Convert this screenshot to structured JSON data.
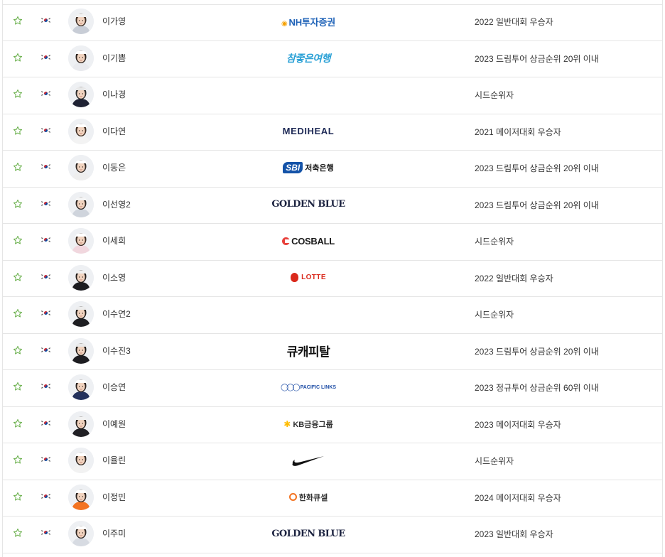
{
  "colors": {
    "favorite_star": "#6ab04c",
    "border": "#e5e5e5",
    "text": "#333333"
  },
  "players": [
    {
      "name": "이가영",
      "sponsor": "NH투자증권",
      "sponsor_logo": "nh",
      "status": "2022 일반대회 우승자",
      "avatar": {
        "hair": "#3a2b22",
        "shirt": "#c8cdd6",
        "cap": "#f2f2f2"
      }
    },
    {
      "name": "이기쁨",
      "sponsor": "참좋은여행",
      "sponsor_logo": "chamjoeun",
      "status": "2023 드림투어 상금순위 20위 이내",
      "avatar": {
        "hair": "#2a211c",
        "shirt": "#e9eaee",
        "cap": "#ffffff"
      }
    },
    {
      "name": "이나경",
      "sponsor": "",
      "sponsor_logo": "none",
      "status": "시드순위자",
      "avatar": {
        "hair": "#2b2b2b",
        "shirt": "#1f2233",
        "cap": "#e8e8e8"
      }
    },
    {
      "name": "이다연",
      "sponsor": "MEDIHEAL",
      "sponsor_logo": "mediheal",
      "status": "2021 메이저대회 우승자",
      "avatar": {
        "hair": "#3b2a20",
        "shirt": "#f3f3f3",
        "cap": "#ffffff"
      }
    },
    {
      "name": "이동은",
      "sponsor": "SBI 저축은행",
      "sponsor_logo": "sbi",
      "status": "2023 드림투어 상금순위 20위 이내",
      "avatar": {
        "hair": "#2e2723",
        "shirt": "#eeeeee",
        "cap": "#ffffff"
      }
    },
    {
      "name": "이선영2",
      "sponsor": "GOLDEN BLUE",
      "sponsor_logo": "golden",
      "status": "2023 드림투어 상금순위 20위 이내",
      "avatar": {
        "hair": "#2c2420",
        "shirt": "#cfd4dc",
        "cap": "#f5f5f5"
      }
    },
    {
      "name": "이세희",
      "sponsor": "COSBALL",
      "sponsor_logo": "cosball",
      "status": "시드순위자",
      "avatar": {
        "hair": "#3a2a22",
        "shirt": "#f1d7de",
        "cap": "#ffffff"
      }
    },
    {
      "name": "이소영",
      "sponsor": "LOTTE",
      "sponsor_logo": "lotte",
      "status": "2022 일반대회 우승자",
      "avatar": {
        "hair": "#221c19",
        "shirt": "#1b1b1f",
        "cap": "#f0f0f0"
      }
    },
    {
      "name": "이수연2",
      "sponsor": "",
      "sponsor_logo": "none",
      "status": "시드순위자",
      "avatar": {
        "hair": "#1f1b19",
        "shirt": "#1e1e22",
        "cap": "#ededed"
      }
    },
    {
      "name": "이수진3",
      "sponsor": "큐캐피탈",
      "sponsor_logo": "qcapital",
      "status": "2023 드림투어 상금순위 20위 이내",
      "avatar": {
        "hair": "#1a1614",
        "shirt": "#1d1d21",
        "cap": "#e9e9e9"
      }
    },
    {
      "name": "이승연",
      "sponsor": "PACIFIC LINKS",
      "sponsor_logo": "pacific",
      "status": "2023 정규투어 상금순위 60위 이내",
      "avatar": {
        "hair": "#2a221f",
        "shirt": "#24315c",
        "cap": "#ffffff"
      }
    },
    {
      "name": "이예원",
      "sponsor": "KB금융그룹",
      "sponsor_logo": "kb",
      "status": "2023 메이저대회 우승자",
      "avatar": {
        "hair": "#241e1a",
        "shirt": "#202024",
        "cap": "#f2f2f2"
      }
    },
    {
      "name": "이율린",
      "sponsor": "NIKE",
      "sponsor_logo": "nike",
      "status": "시드순위자",
      "avatar": {
        "hair": "#2f2722",
        "shirt": "#f2f2f2",
        "cap": "#ffffff"
      }
    },
    {
      "name": "이정민",
      "sponsor": "한화큐셀",
      "sponsor_logo": "hanwha",
      "status": "2024 메이저대회 우승자",
      "avatar": {
        "hair": "#2a2320",
        "shirt": "#f37321",
        "cap": "#ffffff"
      }
    },
    {
      "name": "이주미",
      "sponsor": "GOLDEN BLUE",
      "sponsor_logo": "golden",
      "status": "2023 일반대회 우승자",
      "avatar": {
        "hair": "#2d2521",
        "shirt": "#d7dbe2",
        "cap": "#ffffff"
      }
    }
  ]
}
